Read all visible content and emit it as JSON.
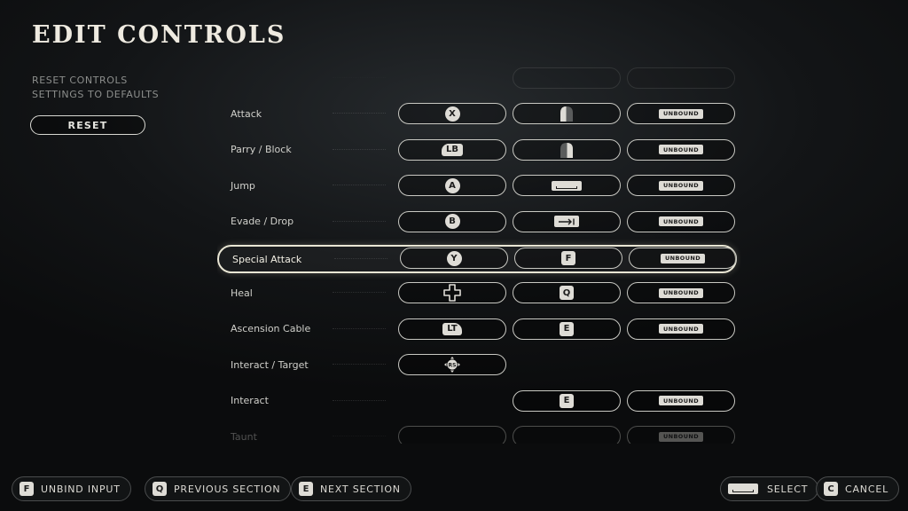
{
  "page": {
    "title": "EDIT CONTROLS"
  },
  "reset": {
    "description_line1": "RESET CONTROLS",
    "description_line2": "SETTINGS TO DEFAULTS",
    "button_label": "RESET"
  },
  "list": {
    "rows": [
      {
        "label": "",
        "state": "faded",
        "slots": [
          {
            "type": "empty"
          },
          {
            "type": "blank"
          },
          {
            "type": "blank"
          }
        ]
      },
      {
        "label": "Attack",
        "state": "normal",
        "slots": [
          {
            "type": "face",
            "text": "X"
          },
          {
            "type": "mouse-left",
            "name": "mouse-left-click-icon"
          },
          {
            "type": "unbound",
            "text": "UNBOUND"
          }
        ]
      },
      {
        "label": "Parry / Block",
        "state": "normal",
        "slots": [
          {
            "type": "bumper",
            "text": "LB"
          },
          {
            "type": "mouse-right",
            "name": "mouse-right-click-icon"
          },
          {
            "type": "unbound",
            "text": "UNBOUND"
          }
        ]
      },
      {
        "label": "Jump",
        "state": "normal",
        "slots": [
          {
            "type": "face",
            "text": "A"
          },
          {
            "type": "spacebar",
            "name": "spacebar-key-icon"
          },
          {
            "type": "unbound",
            "text": "UNBOUND"
          }
        ]
      },
      {
        "label": "Evade / Drop",
        "state": "normal",
        "slots": [
          {
            "type": "face",
            "text": "B"
          },
          {
            "type": "tab",
            "name": "tab-key-icon"
          },
          {
            "type": "unbound",
            "text": "UNBOUND"
          }
        ]
      },
      {
        "label": "Special Attack",
        "state": "selected",
        "slots": [
          {
            "type": "face",
            "text": "Y"
          },
          {
            "type": "key",
            "text": "F"
          },
          {
            "type": "unbound",
            "text": "UNBOUND"
          }
        ]
      },
      {
        "label": "Heal",
        "state": "normal",
        "slots": [
          {
            "type": "dpad",
            "name": "dpad-icon"
          },
          {
            "type": "key",
            "text": "Q"
          },
          {
            "type": "unbound",
            "text": "UNBOUND"
          }
        ]
      },
      {
        "label": "Ascension Cable",
        "state": "normal",
        "slots": [
          {
            "type": "trigger",
            "text": "LT"
          },
          {
            "type": "key",
            "text": "E"
          },
          {
            "type": "unbound",
            "text": "UNBOUND"
          }
        ]
      },
      {
        "label": "Interact / Target",
        "state": "normal",
        "slots": [
          {
            "type": "stick",
            "text": "RS",
            "name": "right-stick-icon"
          },
          {
            "type": "empty"
          },
          {
            "type": "empty"
          }
        ]
      },
      {
        "label": "Interact",
        "state": "normal",
        "slots": [
          {
            "type": "empty"
          },
          {
            "type": "key",
            "text": "E"
          },
          {
            "type": "unbound",
            "text": "UNBOUND"
          }
        ]
      },
      {
        "label": "Taunt",
        "state": "peek",
        "slots": [
          {
            "type": "blank"
          },
          {
            "type": "blank"
          },
          {
            "type": "unbound",
            "text": "UNBOUND"
          }
        ]
      }
    ]
  },
  "footer": {
    "unbind": {
      "key": "F",
      "label": "UNBIND INPUT"
    },
    "previous": {
      "key": "Q",
      "label": "PREVIOUS SECTION"
    },
    "next": {
      "key": "E",
      "label": "NEXT SECTION"
    },
    "select": {
      "label": "SELECT"
    },
    "cancel": {
      "key": "C",
      "label": "CANCEL"
    }
  }
}
